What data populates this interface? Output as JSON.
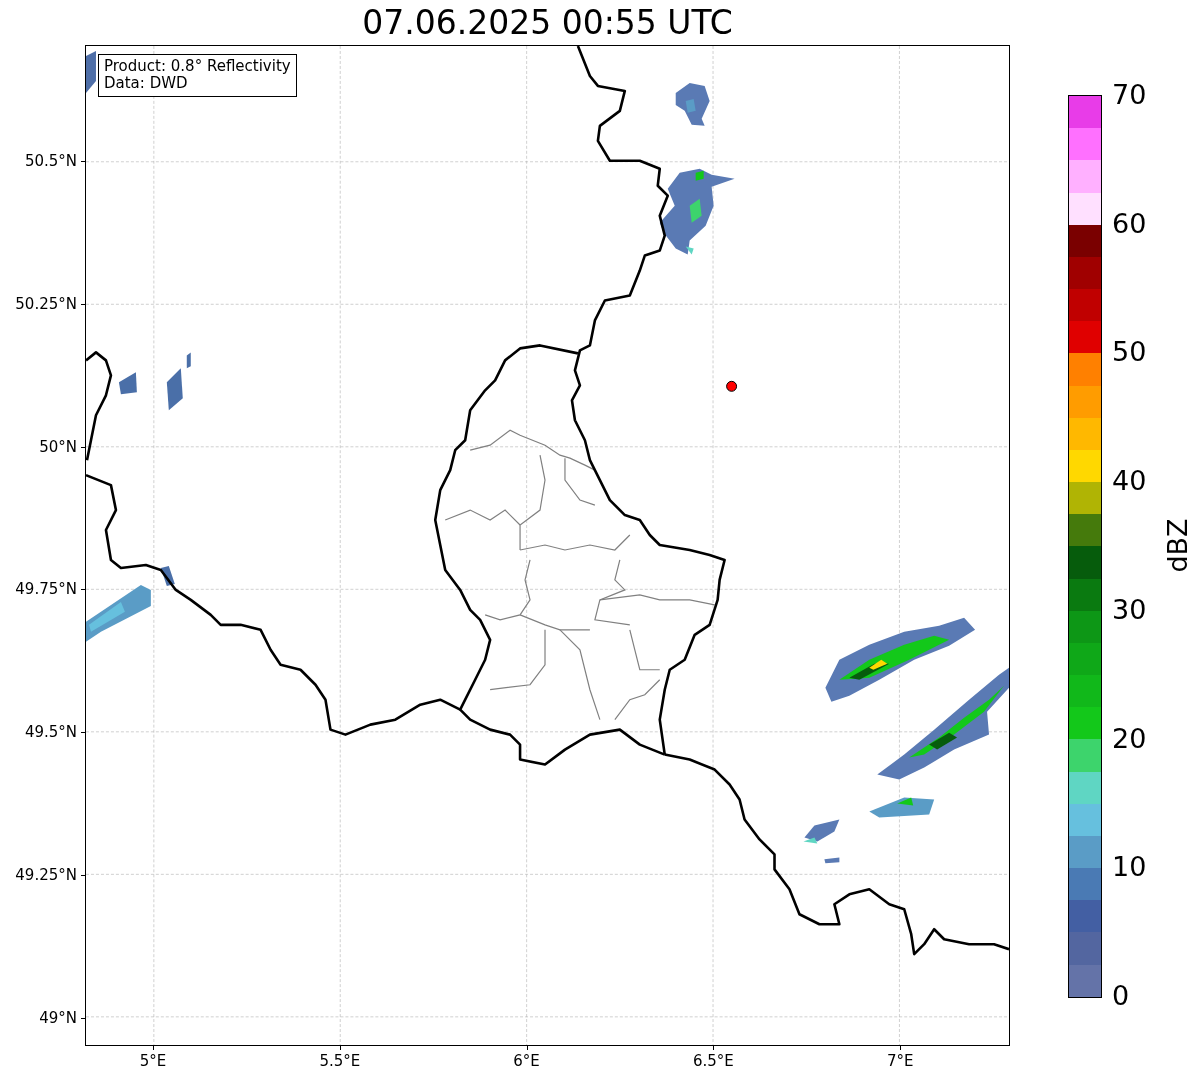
{
  "title": "07.06.2025 00:55 UTC",
  "info_box": {
    "lines": [
      "Product: 0.8° Reflectivity",
      "Data: DWD"
    ]
  },
  "lat_ticks": [
    "50.5°N",
    "50.25°N",
    "50°N",
    "49.75°N",
    "49.5°N",
    "49.25°N",
    "49°N"
  ],
  "lon_ticks": [
    "5°E",
    "5.5°E",
    "6°E",
    "6.5°E",
    "7°E"
  ],
  "colorbar": {
    "label": "dBZ",
    "ticks": [
      "70",
      "60",
      "50",
      "40",
      "30",
      "20",
      "10",
      "0"
    ],
    "bands": [
      {
        "color": "#e83ce8"
      },
      {
        "color": "#ff70ff"
      },
      {
        "color": "#ffb0ff"
      },
      {
        "color": "#ffe0ff"
      },
      {
        "color": "#7a0000"
      },
      {
        "color": "#a00000"
      },
      {
        "color": "#c00000"
      },
      {
        "color": "#e00000"
      },
      {
        "color": "#ff8000"
      },
      {
        "color": "#ff9c00"
      },
      {
        "color": "#ffb800"
      },
      {
        "color": "#ffd800"
      },
      {
        "color": "#b0b404"
      },
      {
        "color": "#457a0c"
      },
      {
        "color": "#065c0c"
      },
      {
        "color": "#0a7a10"
      },
      {
        "color": "#0d9716"
      },
      {
        "color": "#0fa818"
      },
      {
        "color": "#11b81a"
      },
      {
        "color": "#13c81a"
      },
      {
        "color": "#3dd46c"
      },
      {
        "color": "#5fd6c3"
      },
      {
        "color": "#66c0de"
      },
      {
        "color": "#5a9cc6"
      },
      {
        "color": "#4a7ab4"
      },
      {
        "color": "#435fa3"
      },
      {
        "color": "#5366a0"
      },
      {
        "color": "#6473a8"
      }
    ]
  }
}
